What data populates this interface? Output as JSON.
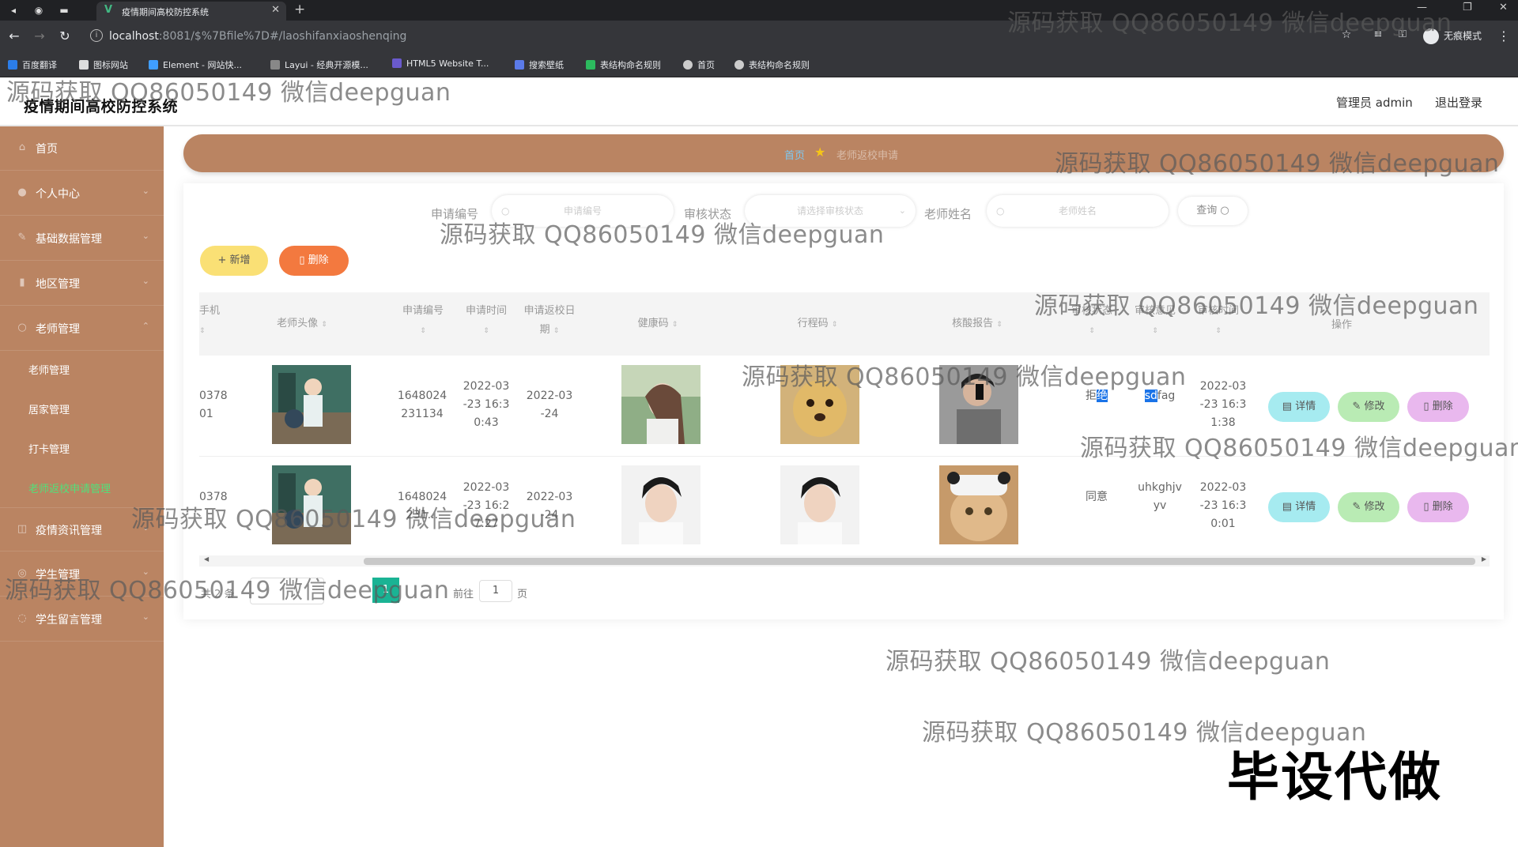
{
  "browser": {
    "tab_title": "疫情期间高校防控系统",
    "url_host": "localhost",
    "url_path": ":8081/$%7Bfile%7D#/laoshifanxiaoshenqing",
    "incognito_label": "无痕模式",
    "bookmarks": [
      "百度翻译",
      "图标网站",
      "Element - 网站快...",
      "Layui - 经典开源模...",
      "HTML5 Website T...",
      "搜索壁纸",
      "表结构命名规则",
      "首页",
      "表结构命名规则"
    ]
  },
  "header": {
    "title": "疫情期间高校防控系统",
    "admin": "管理员 admin",
    "logout": "退出登录"
  },
  "sidebar": {
    "items": [
      {
        "label": "首页",
        "icon": "home-icon"
      },
      {
        "label": "个人中心",
        "icon": "user-icon"
      },
      {
        "label": "基础数据管理",
        "icon": "data-icon"
      },
      {
        "label": "地区管理",
        "icon": "chart-icon"
      },
      {
        "label": "老师管理",
        "icon": "teacher-icon"
      }
    ],
    "sub_items": [
      "老师管理",
      "居家管理",
      "打卡管理",
      "老师返校申请管理"
    ],
    "items_after": [
      {
        "label": "疫情资讯管理",
        "icon": "news-icon"
      },
      {
        "label": "学生管理",
        "icon": "student-icon"
      },
      {
        "label": "学生留言管理",
        "icon": "message-icon"
      }
    ]
  },
  "breadcrumb": {
    "home": "首页",
    "current": "老师返校申请"
  },
  "search": {
    "label_code": "申请编号",
    "placeholder_code": "申请编号",
    "label_status": "审核状态",
    "placeholder_status": "请选择审核状态",
    "label_name": "老师姓名",
    "placeholder_name": "老师姓名",
    "query_button": "查询"
  },
  "toolbar": {
    "add": "+ 新增",
    "delete": "删除"
  },
  "table": {
    "headers": {
      "phone": "手机",
      "avatar": "老师头像",
      "code": "申请编号",
      "time": "申请时间",
      "return_date": "申请返校日期",
      "health": "健康码",
      "trip": "行程码",
      "nucleic": "核酸报告",
      "status": "审核状态",
      "opinion": "审核意见",
      "review_time": "审核时间",
      "ops": "操作"
    },
    "rows": [
      {
        "phone": "0378\n01",
        "code": "1648024\n231134",
        "time": "2022-03\n-23 16:3\n0:43",
        "return_date": "2022-03\n-24",
        "status_pre": "拒",
        "status_hl": "绝",
        "opinion_hl": "sd",
        "opinion_rest": "fag",
        "review_time": "2022-03\n-23 16:3\n1:38"
      },
      {
        "phone": "0378\n",
        "code": "1648024\n231...",
        "time": "2022-03\n-23 16:2\n7:27",
        "return_date": "2022-03\n-24",
        "status": "同意",
        "opinion": "uhkghjv\nyv",
        "review_time": "2022-03\n-23 16:3\n0:01"
      }
    ],
    "actions": {
      "detail": "详情",
      "edit": "修改",
      "delete": "删除"
    }
  },
  "pagination": {
    "total": "共 2 条",
    "page_size": "10条/页",
    "current_page": "1",
    "goto_label": "前往",
    "goto_value": "1",
    "unit": "页"
  },
  "watermark": "源码获取 QQ86050149 微信deepguan",
  "stamp": "毕设代做",
  "colors": {
    "sidebar": "#ba8462",
    "active_sub": "#52e07a",
    "add_btn": "#fae075",
    "delete_btn": "#f3793f"
  }
}
